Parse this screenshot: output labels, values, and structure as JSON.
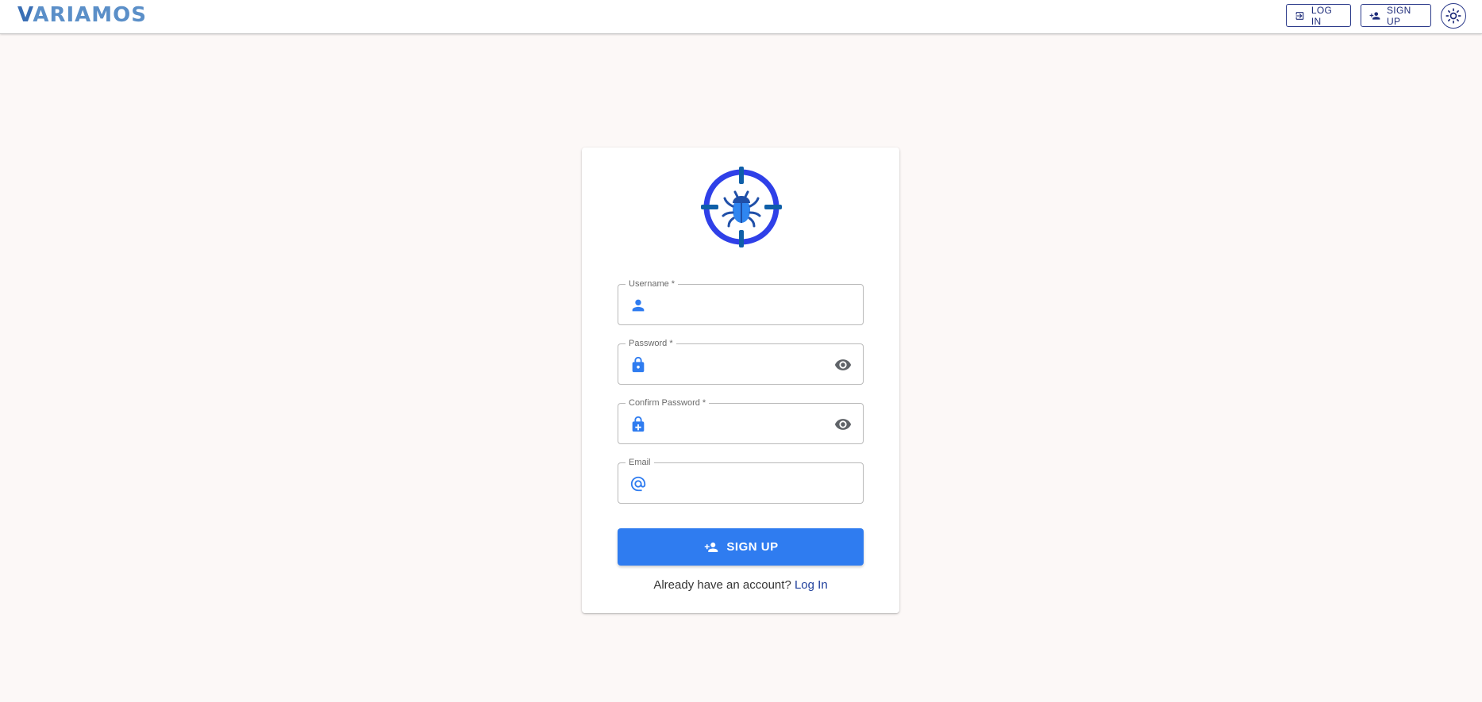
{
  "header": {
    "logo_first": "V",
    "logo_rest": "ARIAMOS",
    "login_label": "LOG IN",
    "signup_label": "SIGN UP"
  },
  "form": {
    "username_label": "Username *",
    "password_label": "Password *",
    "confirm_label": "Confirm Password *",
    "email_label": "Email",
    "username_value": "",
    "password_value": "",
    "confirm_value": "",
    "email_value": "",
    "submit_label": "SIGN UP",
    "footer_text": "Already have an account?",
    "footer_link": "Log In"
  },
  "colors": {
    "accent": "#2f7cf0",
    "nav_border": "#2b3a8a",
    "background": "#fcf8f7"
  },
  "icons": [
    "login-icon",
    "person-add-icon",
    "sun-icon",
    "bug-target-icon",
    "person-icon",
    "lock-icon",
    "lock-plus-icon",
    "email-at-icon",
    "eye-icon"
  ]
}
